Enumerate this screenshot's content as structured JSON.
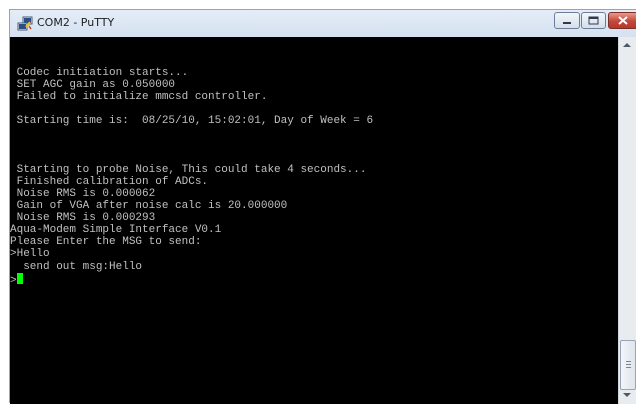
{
  "window": {
    "title": "COM2 - PuTTY",
    "icon": "putty-icon",
    "controls": [
      "minimize-icon",
      "maximize-icon",
      "close-icon"
    ]
  },
  "terminal": {
    "lines": [
      " Codec initiation starts...",
      " SET AGC gain as 0.050000",
      " Failed to initialize mmcsd controller.",
      "",
      " Starting time is:  08/25/10, 15:02:01, Day of Week = 6",
      "",
      "",
      "",
      " Starting to probe Noise, This could take 4 seconds...",
      " Finished calibration of ADCs.",
      " Noise RMS is 0.000062",
      " Gain of VGA after noise calc is 20.000000",
      " Noise RMS is 0.000293",
      "Aqua-Modem Simple Interface V0.1",
      "Please Enter the MSG to send:",
      ">Hello",
      "  send out msg:Hello"
    ],
    "prompt": ">",
    "colors": {
      "background": "#000000",
      "text": "#c0c0c0",
      "cursor": "#00ff00"
    }
  },
  "scrollbar": {
    "up": "scroll-up-arrow-icon",
    "down": "scroll-down-arrow-icon",
    "position": 1.0
  }
}
